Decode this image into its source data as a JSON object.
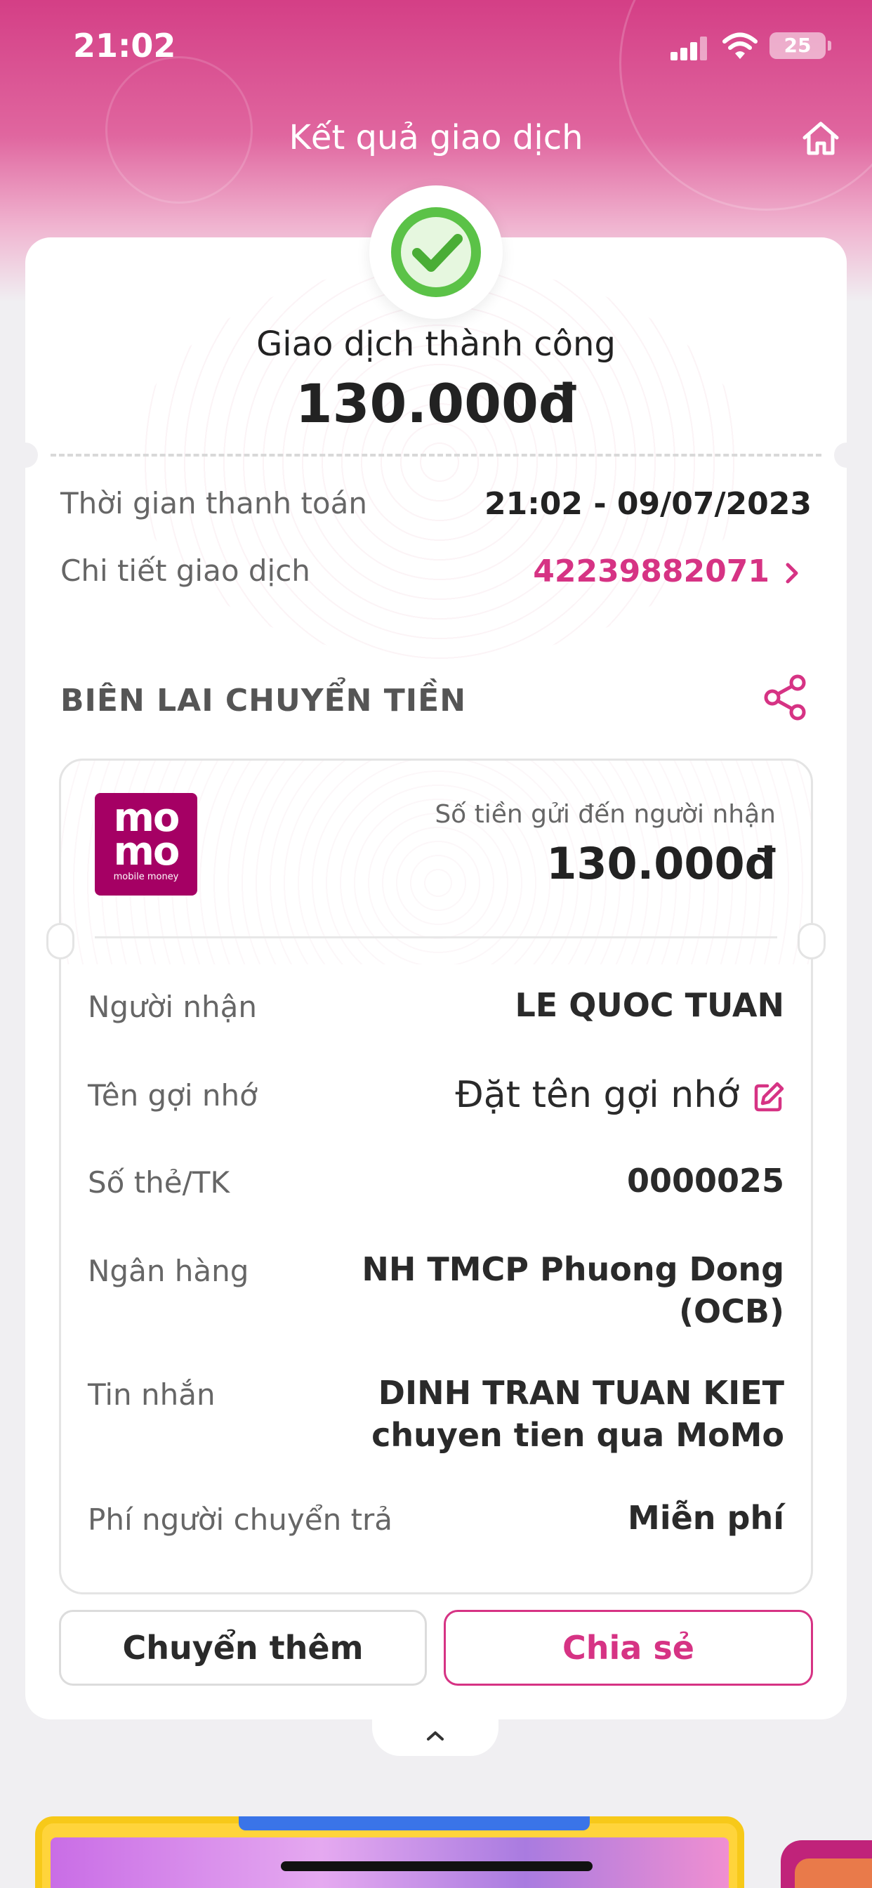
{
  "status_bar": {
    "time": "21:02",
    "battery": "25"
  },
  "header": {
    "title": "Kết quả giao dịch",
    "home_icon": "home-icon"
  },
  "result": {
    "status_text": "Giao dịch thành công",
    "amount": "130.000đ",
    "icon": "check-circle-icon",
    "rows": [
      {
        "label": "Thời gian thanh toán",
        "value": "21:02 - 09/07/2023"
      },
      {
        "label": "Chi tiết giao dịch",
        "value": "42239882071"
      }
    ]
  },
  "receipt": {
    "section_title": "BIÊN LAI CHUYỂN TIỀN",
    "logo_text_1": "mo",
    "logo_text_2": "mo",
    "logo_tagline": "mobile money",
    "amount_label": "Số tiền gửi đến người nhận",
    "amount": "130.000đ",
    "rows": [
      {
        "label": "Người nhận",
        "value": "LE QUOC TUAN"
      },
      {
        "label": "Tên gợi nhớ",
        "value": "Đặt tên gợi nhớ"
      },
      {
        "label": "Số thẻ/TK",
        "value": "0000025"
      },
      {
        "label": "Ngân hàng",
        "value_line1": "NH TMCP Phuong Dong",
        "value_line2": "(OCB)"
      },
      {
        "label": "Tin nhắn",
        "value_line1": "DINH TRAN TUAN KIET",
        "value_line2": "chuyen tien qua MoMo"
      },
      {
        "label": "Phí người chuyển trả",
        "value": "Miễn phí"
      }
    ]
  },
  "actions": {
    "transfer_more": "Chuyển thêm",
    "share": "Chia sẻ"
  },
  "colors": {
    "brand_pink": "#d63384",
    "success_green": "#5bc247",
    "momo_purple": "#a50064"
  }
}
